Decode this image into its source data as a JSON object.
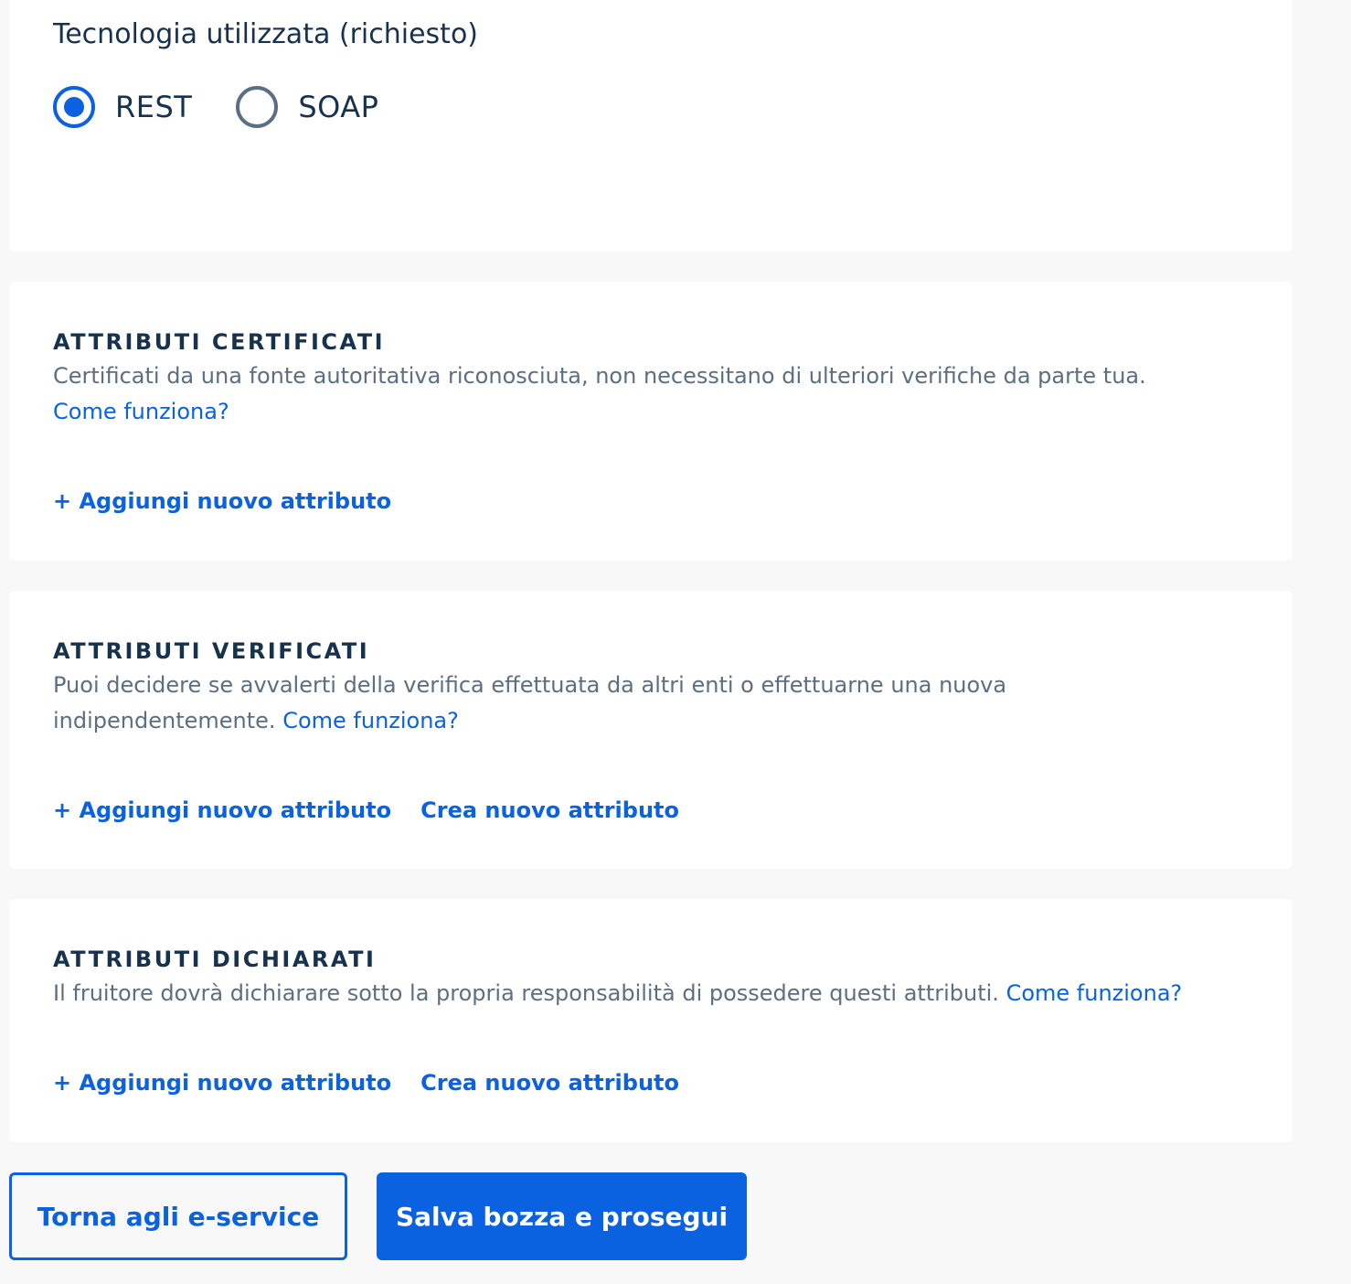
{
  "technology": {
    "label": "Tecnologia utilizzata (richiesto)",
    "options": [
      {
        "label": "REST",
        "selected": true
      },
      {
        "label": "SOAP",
        "selected": false
      }
    ]
  },
  "certified": {
    "title": "ATTRIBUTI CERTIFICATI",
    "description": "Certificati da una fonte autoritativa riconosciuta, non necessitano di ulteriori verifiche da parte tua.",
    "help_link": "Come funziona?",
    "add_label": "+ Aggiungi nuovo attributo"
  },
  "verified": {
    "title": "ATTRIBUTI VERIFICATI",
    "description": "Puoi decidere se avvalerti della verifica effettuata da altri enti o effettuarne una nuova indipendentemente.",
    "help_link": "Come funziona?",
    "add_label": "+ Aggiungi nuovo attributo",
    "create_label": "Crea nuovo attributo"
  },
  "declared": {
    "title": "ATTRIBUTI DICHIARATI",
    "description": "Il fruitore dovrà dichiarare sotto la propria responsabilità di possedere questi attributi.",
    "help_link": "Come funziona?",
    "add_label": "+ Aggiungi nuovo attributo",
    "create_label": "Crea nuovo attributo"
  },
  "footer": {
    "back_label": "Torna agli e-service",
    "save_label": "Salva bozza e prosegui"
  },
  "colors": {
    "primary": "#0b62e0",
    "text": "#17324d",
    "muted": "#5c6f82",
    "background": "#f8f8f8"
  }
}
